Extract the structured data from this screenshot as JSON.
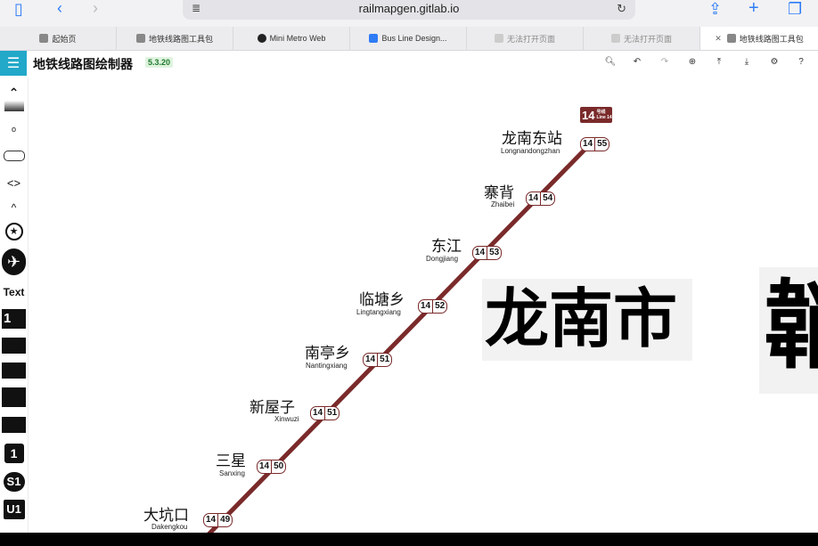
{
  "browser": {
    "url": "railmapgen.gitlab.io",
    "tabs": [
      {
        "label": "起始页",
        "active": false
      },
      {
        "label": "地铁线路图工具包",
        "active": false
      },
      {
        "label": "Mini Metro Web",
        "active": false
      },
      {
        "label": "Bus Line Design...",
        "active": false
      },
      {
        "label": "无法打开页面",
        "active": false
      },
      {
        "label": "无法打开页面",
        "active": false
      },
      {
        "label": "地铁线路图工具包",
        "active": true
      }
    ]
  },
  "app": {
    "title": "地铁线路图绘制器",
    "version": "5.3.20"
  },
  "sidebar": {
    "items": [
      "",
      "",
      "",
      "<>",
      "^",
      "",
      "",
      "Text",
      "",
      "",
      "",
      "",
      "",
      "",
      "1",
      "S1",
      "U1"
    ]
  },
  "canvas": {
    "city_name": "龙南市",
    "city_name_partial": "韒",
    "line_badge": {
      "number": "14",
      "zh": "号线",
      "en": "Line 14"
    },
    "line_color": "#7a2a2a",
    "stations": [
      {
        "zh": "龙南东站",
        "en": "Longnandongzhan",
        "line": "14",
        "code": "55"
      },
      {
        "zh": "寨背",
        "en": "Zhaibei",
        "line": "14",
        "code": "54"
      },
      {
        "zh": "东江",
        "en": "Dongjiang",
        "line": "14",
        "code": "53"
      },
      {
        "zh": "临塘乡",
        "en": "Lingtangxiang",
        "line": "14",
        "code": "52"
      },
      {
        "zh": "南亭乡",
        "en": "Nantingxiang",
        "line": "14",
        "code": "51"
      },
      {
        "zh": "新屋子",
        "en": "Xinwuzi",
        "line": "14",
        "code": "51"
      },
      {
        "zh": "三星",
        "en": "Sanxing",
        "line": "14",
        "code": "50"
      },
      {
        "zh": "大坑口",
        "en": "Dakengkou",
        "line": "14",
        "code": "49"
      }
    ]
  }
}
